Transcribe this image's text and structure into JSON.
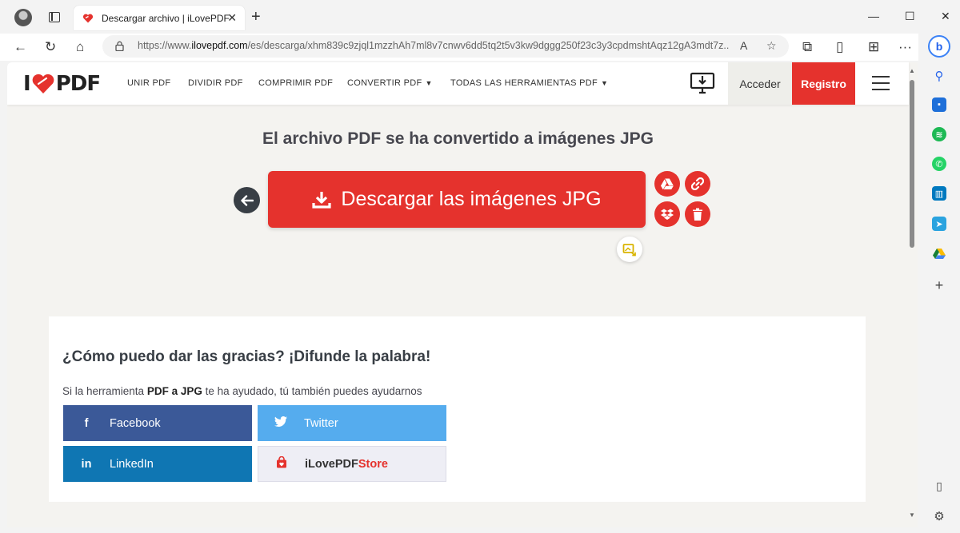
{
  "browser": {
    "tab_title": "Descargar archivo | iLovePDF",
    "tab_close": "✕",
    "new_tab": "+",
    "window_controls": {
      "minimize": "—",
      "maximize": "☐",
      "close": "✕"
    },
    "url_prefix": "https://www.",
    "url_domain": "ilovepdf.com",
    "url_path": "/es/descarga/xhm839c9zjql1mzzhAh7ml8v7cnwv6dd5tq2t5v3kw9dggg250f23c3y3cpdmshtAqz12gA3mdt7z...",
    "read_aloud": "A",
    "more": "···"
  },
  "site": {
    "logo_left": "I",
    "logo_right": "PDF",
    "nav": [
      {
        "label": "UNIR PDF"
      },
      {
        "label": "DIVIDIR PDF"
      },
      {
        "label": "COMPRIMIR PDF"
      },
      {
        "label": "CONVERTIR PDF",
        "dropdown": true
      },
      {
        "label": "TODAS LAS HERRAMIENTAS PDF",
        "dropdown": true
      }
    ],
    "caret": "▼",
    "login": "Acceder",
    "signup": "Registro"
  },
  "main": {
    "title": "El archivo PDF se ha convertido a imágenes JPG",
    "download_label": "Descargar las imágenes JPG"
  },
  "share": {
    "title": "¿Cómo puedo dar las gracias? ¡Difunde la palabra!",
    "sub_before": "Si la herramienta ",
    "sub_tool": "PDF a JPG",
    "sub_after": " te ha ayudado, tú también puedes ayudarnos",
    "buttons": {
      "facebook": "Facebook",
      "twitter": "Twitter",
      "linkedin": "LinkedIn",
      "store_a": "iLovePDF",
      "store_b": "Store"
    }
  },
  "colors": {
    "brand_red": "#e5322d",
    "facebook": "#3b5998",
    "twitter": "#55acee",
    "linkedin": "#0f76b3"
  }
}
